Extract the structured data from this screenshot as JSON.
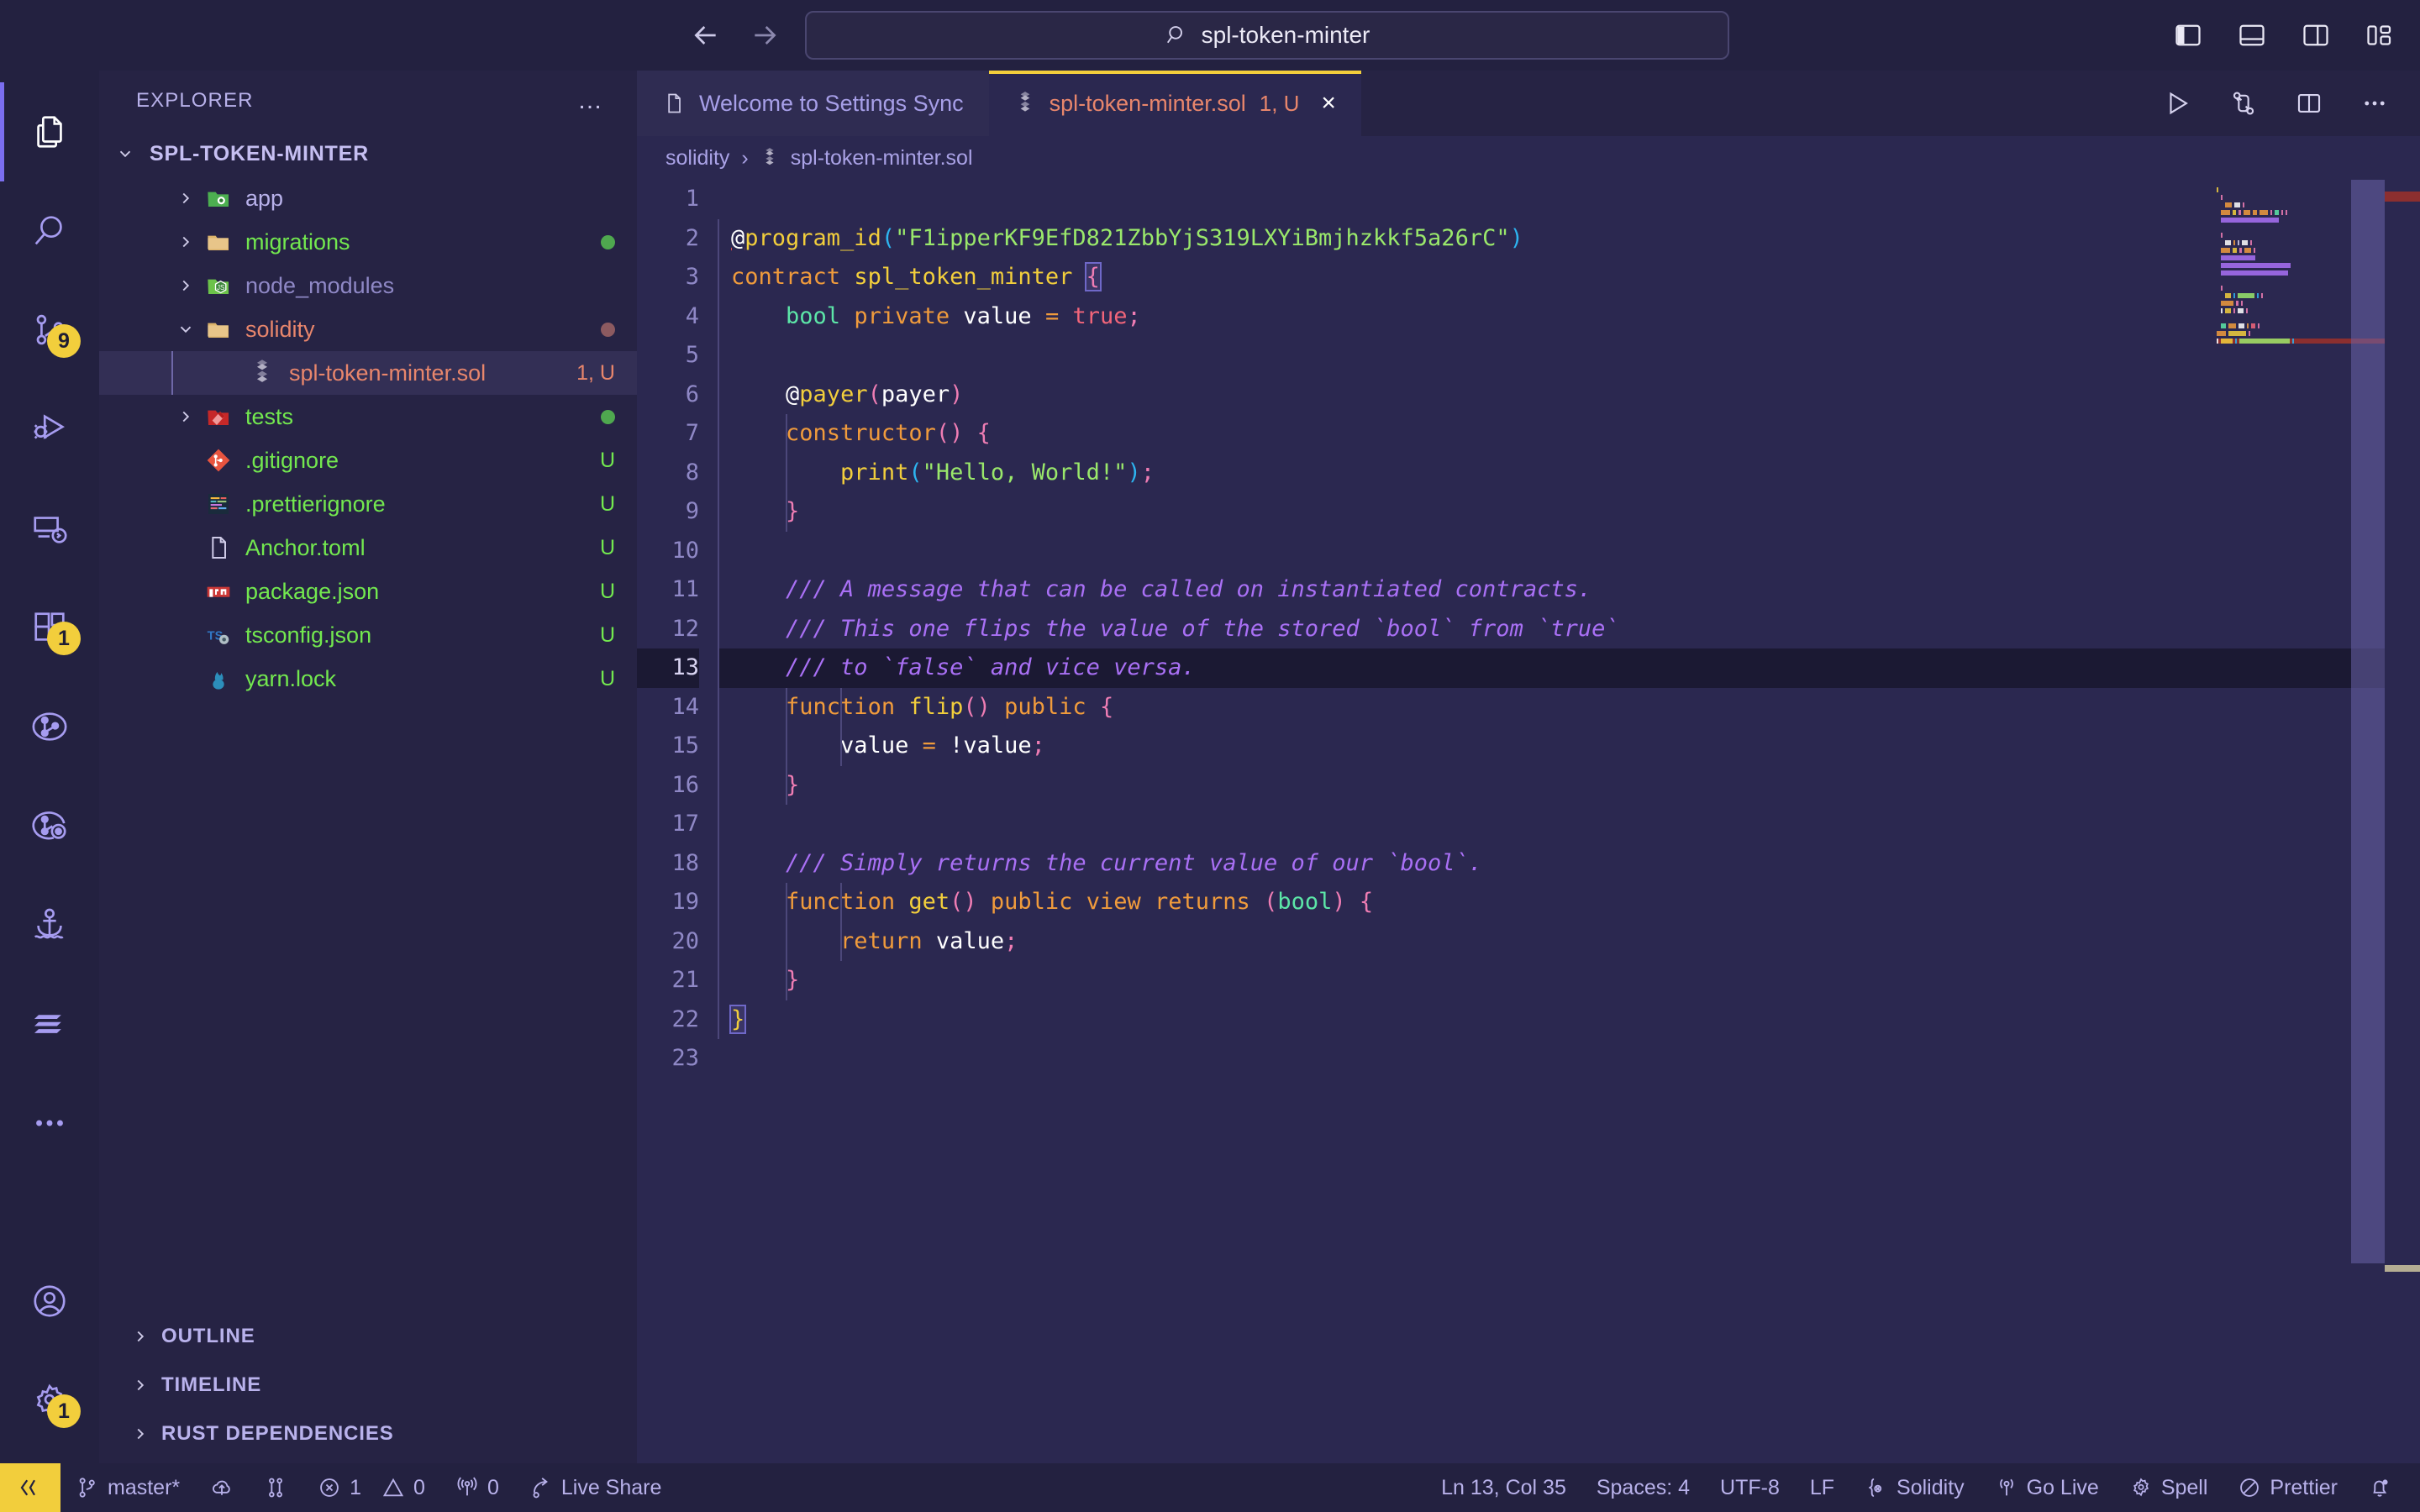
{
  "titlebar": {
    "back_label": "Back",
    "forward_label": "Forward",
    "search_value": "spl-token-minter",
    "search_icon": "search-icon",
    "layout_icons": [
      "toggle-primary-sidebar-icon",
      "toggle-panel-icon",
      "toggle-secondary-sidebar-icon",
      "customize-layout-icon"
    ]
  },
  "activitybar": {
    "items": [
      {
        "name": "explorer",
        "icon": "files-icon",
        "badge": "",
        "active": true
      },
      {
        "name": "search",
        "icon": "search-icon",
        "badge": "",
        "active": false
      },
      {
        "name": "source-control",
        "icon": "source-control-icon",
        "badge": "9",
        "active": false
      },
      {
        "name": "run-and-debug",
        "icon": "debug-icon",
        "badge": "",
        "active": false
      },
      {
        "name": "remote-explorer",
        "icon": "remote-explorer-icon",
        "badge": "",
        "active": false
      },
      {
        "name": "extensions",
        "icon": "extensions-icon",
        "badge": "1",
        "active": false
      },
      {
        "name": "git-graph",
        "icon": "git-graph-icon",
        "badge": "",
        "active": false
      },
      {
        "name": "gitlens",
        "icon": "gitlens-icon",
        "badge": "",
        "active": false
      },
      {
        "name": "anchor",
        "icon": "anchor-icon",
        "badge": "",
        "active": false
      },
      {
        "name": "solana",
        "icon": "solana-icon",
        "badge": "",
        "active": false
      },
      {
        "name": "additional-views",
        "icon": "ellipsis-icon",
        "badge": "",
        "active": false
      }
    ],
    "bottom_items": [
      {
        "name": "accounts",
        "icon": "account-icon",
        "badge": ""
      },
      {
        "name": "manage-settings",
        "icon": "gear-icon",
        "badge": "1"
      }
    ]
  },
  "sidebar": {
    "title": "EXPLORER",
    "more_actions": "…",
    "root": {
      "label": "SPL-TOKEN-MINTER",
      "expanded": true
    },
    "tree": [
      {
        "name": "app",
        "type": "folder",
        "icon": "folder-app-icon",
        "expanded": false,
        "status": "",
        "status_color": "",
        "dot": "",
        "color": "#b8b1ea",
        "indent": 1
      },
      {
        "name": "migrations",
        "type": "folder",
        "icon": "folder-icon",
        "expanded": false,
        "status": "",
        "status_color": "",
        "dot": "#4fa84f",
        "color": "#73e84f",
        "indent": 1
      },
      {
        "name": "node_modules",
        "type": "folder",
        "icon": "folder-node-icon",
        "expanded": false,
        "status": "",
        "status_color": "",
        "dot": "",
        "color": "#8f88c6",
        "indent": 1
      },
      {
        "name": "solidity",
        "type": "folder",
        "icon": "folder-icon",
        "expanded": true,
        "status": "",
        "status_color": "",
        "dot": "#8c5a60",
        "color": "#e8866c",
        "indent": 1
      },
      {
        "name": "spl-token-minter.sol",
        "type": "file",
        "icon": "solidity-icon",
        "expanded": null,
        "status": "1, U",
        "status_color": "#e8866c",
        "dot": "",
        "color": "#e8866c",
        "indent": 2,
        "selected": true
      },
      {
        "name": "tests",
        "type": "folder",
        "icon": "folder-test-icon",
        "expanded": false,
        "status": "",
        "status_color": "",
        "dot": "#4fa84f",
        "color": "#73e84f",
        "indent": 1
      },
      {
        "name": ".gitignore",
        "type": "file",
        "icon": "git-icon",
        "expanded": null,
        "status": "U",
        "status_color": "#73e84f",
        "dot": "",
        "color": "#73e84f",
        "indent": 1
      },
      {
        "name": ".prettierignore",
        "type": "file",
        "icon": "prettier-icon",
        "expanded": null,
        "status": "U",
        "status_color": "#73e84f",
        "dot": "",
        "color": "#73e84f",
        "indent": 1
      },
      {
        "name": "Anchor.toml",
        "type": "file",
        "icon": "file-icon",
        "expanded": null,
        "status": "U",
        "status_color": "#73e84f",
        "dot": "",
        "color": "#73e84f",
        "indent": 1
      },
      {
        "name": "package.json",
        "type": "file",
        "icon": "npm-icon",
        "expanded": null,
        "status": "U",
        "status_color": "#73e84f",
        "dot": "",
        "color": "#73e84f",
        "indent": 1
      },
      {
        "name": "tsconfig.json",
        "type": "file",
        "icon": "tsconfig-icon",
        "expanded": null,
        "status": "U",
        "status_color": "#73e84f",
        "dot": "",
        "color": "#73e84f",
        "indent": 1
      },
      {
        "name": "yarn.lock",
        "type": "file",
        "icon": "yarn-icon",
        "expanded": null,
        "status": "U",
        "status_color": "#73e84f",
        "dot": "",
        "color": "#73e84f",
        "indent": 1
      }
    ],
    "sections": [
      {
        "label": "OUTLINE",
        "expanded": false
      },
      {
        "label": "TIMELINE",
        "expanded": false
      },
      {
        "label": "RUST DEPENDENCIES",
        "expanded": false
      }
    ]
  },
  "editor": {
    "tabs": [
      {
        "label": "Welcome to Settings Sync",
        "icon": "file-icon",
        "status": "",
        "active": false,
        "closable": false
      },
      {
        "label": "spl-token-minter.sol",
        "icon": "solidity-icon",
        "status": "1, U",
        "active": true,
        "closable": true,
        "close_label": "×"
      }
    ],
    "actions": [
      "run-icon",
      "compare-changes-icon",
      "split-editor-icon",
      "more-actions-icon"
    ],
    "breadcrumb": [
      "solidity",
      "spl-token-minter.sol"
    ],
    "breadcrumb_separator": "›",
    "breadcrumb_file_icon": "solidity-icon",
    "current_line": 13,
    "line_numbers": [
      1,
      2,
      3,
      4,
      5,
      6,
      7,
      8,
      9,
      10,
      11,
      12,
      13,
      14,
      15,
      16,
      17,
      18,
      19,
      20,
      21,
      22,
      23
    ],
    "code_lines": [
      {
        "n": 1,
        "tokens": []
      },
      {
        "n": 2,
        "tokens": [
          {
            "t": "@",
            "c": "t-at",
            "err": true
          },
          {
            "t": "program_id",
            "c": "t-fn"
          },
          {
            "t": "(",
            "c": "t-paren"
          },
          {
            "t": "\"F1ipperKF9EfD821ZbbYjS319LXYiBmjhzkkf5a26rC\"",
            "c": "t-str"
          },
          {
            "t": ")",
            "c": "t-paren"
          }
        ]
      },
      {
        "n": 3,
        "tokens": [
          {
            "t": "contract",
            "c": "t-kw"
          },
          {
            "t": " ",
            "c": "t-plain"
          },
          {
            "t": "spl_token_minter",
            "c": "t-fn"
          },
          {
            "t": " ",
            "c": "t-plain"
          },
          {
            "t": "{",
            "c": "t-punct",
            "match": true
          }
        ]
      },
      {
        "n": 4,
        "tokens": [
          {
            "t": "    ",
            "c": "t-plain"
          },
          {
            "t": "bool",
            "c": "t-type"
          },
          {
            "t": " ",
            "c": "t-plain"
          },
          {
            "t": "private",
            "c": "t-kw"
          },
          {
            "t": " ",
            "c": "t-plain"
          },
          {
            "t": "value",
            "c": "t-name"
          },
          {
            "t": " ",
            "c": "t-plain"
          },
          {
            "t": "=",
            "c": "t-op"
          },
          {
            "t": " ",
            "c": "t-plain"
          },
          {
            "t": "true",
            "c": "t-bool"
          },
          {
            "t": ";",
            "c": "t-punct"
          }
        ]
      },
      {
        "n": 5,
        "tokens": []
      },
      {
        "n": 6,
        "tokens": [
          {
            "t": "    ",
            "c": "t-plain"
          },
          {
            "t": "@",
            "c": "t-at"
          },
          {
            "t": "payer",
            "c": "t-fn"
          },
          {
            "t": "(",
            "c": "t-paren2"
          },
          {
            "t": "payer",
            "c": "t-name"
          },
          {
            "t": ")",
            "c": "t-paren2"
          }
        ]
      },
      {
        "n": 7,
        "tokens": [
          {
            "t": "    ",
            "c": "t-plain"
          },
          {
            "t": "constructor",
            "c": "t-kw"
          },
          {
            "t": "()",
            "c": "t-paren2"
          },
          {
            "t": " ",
            "c": "t-plain"
          },
          {
            "t": "{",
            "c": "t-punct"
          }
        ]
      },
      {
        "n": 8,
        "tokens": [
          {
            "t": "        ",
            "c": "t-plain"
          },
          {
            "t": "print",
            "c": "t-fn"
          },
          {
            "t": "(",
            "c": "t-paren"
          },
          {
            "t": "\"Hello, World!\"",
            "c": "t-str"
          },
          {
            "t": ")",
            "c": "t-paren"
          },
          {
            "t": ";",
            "c": "t-punct"
          }
        ]
      },
      {
        "n": 9,
        "tokens": [
          {
            "t": "    ",
            "c": "t-plain"
          },
          {
            "t": "}",
            "c": "t-punct"
          }
        ]
      },
      {
        "n": 10,
        "tokens": []
      },
      {
        "n": 11,
        "tokens": [
          {
            "t": "    ",
            "c": "t-plain"
          },
          {
            "t": "/// A message that can be called on instantiated contracts.",
            "c": "t-com"
          }
        ]
      },
      {
        "n": 12,
        "tokens": [
          {
            "t": "    ",
            "c": "t-plain"
          },
          {
            "t": "/// This one flips the value of the stored `bool` from `true`",
            "c": "t-com"
          }
        ]
      },
      {
        "n": 13,
        "tokens": [
          {
            "t": "    ",
            "c": "t-plain"
          },
          {
            "t": "/// to `false` and vice versa.",
            "c": "t-com"
          }
        ]
      },
      {
        "n": 14,
        "tokens": [
          {
            "t": "    ",
            "c": "t-plain"
          },
          {
            "t": "function",
            "c": "t-kw"
          },
          {
            "t": " ",
            "c": "t-plain"
          },
          {
            "t": "flip",
            "c": "t-fn"
          },
          {
            "t": "()",
            "c": "t-paren2"
          },
          {
            "t": " ",
            "c": "t-plain"
          },
          {
            "t": "public",
            "c": "t-kw"
          },
          {
            "t": " ",
            "c": "t-plain"
          },
          {
            "t": "{",
            "c": "t-punct"
          }
        ]
      },
      {
        "n": 15,
        "tokens": [
          {
            "t": "        ",
            "c": "t-plain"
          },
          {
            "t": "value",
            "c": "t-name"
          },
          {
            "t": " ",
            "c": "t-plain"
          },
          {
            "t": "=",
            "c": "t-op"
          },
          {
            "t": " ",
            "c": "t-plain"
          },
          {
            "t": "!",
            "c": "t-plain"
          },
          {
            "t": "value",
            "c": "t-name"
          },
          {
            "t": ";",
            "c": "t-punct"
          }
        ]
      },
      {
        "n": 16,
        "tokens": [
          {
            "t": "    ",
            "c": "t-plain"
          },
          {
            "t": "}",
            "c": "t-punct"
          }
        ]
      },
      {
        "n": 17,
        "tokens": []
      },
      {
        "n": 18,
        "tokens": [
          {
            "t": "    ",
            "c": "t-plain"
          },
          {
            "t": "/// Simply returns the current value of our `bool`.",
            "c": "t-com"
          }
        ]
      },
      {
        "n": 19,
        "tokens": [
          {
            "t": "    ",
            "c": "t-plain"
          },
          {
            "t": "function",
            "c": "t-kw"
          },
          {
            "t": " ",
            "c": "t-plain"
          },
          {
            "t": "get",
            "c": "t-fn"
          },
          {
            "t": "()",
            "c": "t-paren2"
          },
          {
            "t": " ",
            "c": "t-plain"
          },
          {
            "t": "public",
            "c": "t-kw"
          },
          {
            "t": " ",
            "c": "t-plain"
          },
          {
            "t": "view",
            "c": "t-kw"
          },
          {
            "t": " ",
            "c": "t-plain"
          },
          {
            "t": "returns",
            "c": "t-kw"
          },
          {
            "t": " ",
            "c": "t-plain"
          },
          {
            "t": "(",
            "c": "t-paren2"
          },
          {
            "t": "bool",
            "c": "t-type"
          },
          {
            "t": ")",
            "c": "t-paren2"
          },
          {
            "t": " ",
            "c": "t-plain"
          },
          {
            "t": "{",
            "c": "t-punct"
          }
        ]
      },
      {
        "n": 20,
        "tokens": [
          {
            "t": "        ",
            "c": "t-plain"
          },
          {
            "t": "return",
            "c": "t-kw"
          },
          {
            "t": " ",
            "c": "t-plain"
          },
          {
            "t": "value",
            "c": "t-name"
          },
          {
            "t": ";",
            "c": "t-punct"
          }
        ]
      },
      {
        "n": 21,
        "tokens": [
          {
            "t": "    ",
            "c": "t-plain"
          },
          {
            "t": "}",
            "c": "t-punct"
          }
        ]
      },
      {
        "n": 22,
        "tokens": [
          {
            "t": "}",
            "c": "t-fn",
            "match": true
          }
        ]
      },
      {
        "n": 23,
        "tokens": []
      }
    ]
  },
  "statusbar": {
    "remote_icon": "remote-window-icon",
    "left": [
      {
        "name": "branch",
        "icon": "branch-icon",
        "label": "master*"
      },
      {
        "name": "sync",
        "icon": "sync-cloud-icon",
        "label": ""
      },
      {
        "name": "git-fork",
        "icon": "git-compare-icon",
        "label": ""
      },
      {
        "name": "errors",
        "icon": "error-icon",
        "label": "1"
      },
      {
        "name": "warnings",
        "icon": "warning-icon",
        "label": "0"
      },
      {
        "name": "ports",
        "icon": "radio-tower-icon",
        "label": "0"
      },
      {
        "name": "live-share",
        "icon": "live-share-icon",
        "label": "Live Share"
      }
    ],
    "right": [
      {
        "name": "cursor-position",
        "icon": "",
        "label": "Ln 13, Col 35"
      },
      {
        "name": "indentation",
        "icon": "",
        "label": "Spaces: 4"
      },
      {
        "name": "encoding",
        "icon": "",
        "label": "UTF-8"
      },
      {
        "name": "eol",
        "icon": "",
        "label": "LF"
      },
      {
        "name": "language-mode",
        "icon": "solidity-status-icon",
        "label": "Solidity"
      },
      {
        "name": "go-live",
        "icon": "broadcast-icon",
        "label": "Go Live"
      },
      {
        "name": "spell-checker",
        "icon": "spell-icon",
        "label": "Spell"
      },
      {
        "name": "prettier",
        "icon": "prettier-status-icon",
        "label": "Prettier"
      },
      {
        "name": "notifications",
        "icon": "bell-icon",
        "label": ""
      }
    ]
  },
  "colors": {
    "background": "#232140",
    "editor_background": "#2b2850",
    "sidebar_background": "#262344",
    "accent": "#f2ce3c",
    "selection": "#332f55",
    "current_line": "#1b1933",
    "error": "#e05252",
    "modified": "#73e84f",
    "foreground": "#b8b1ea"
  }
}
